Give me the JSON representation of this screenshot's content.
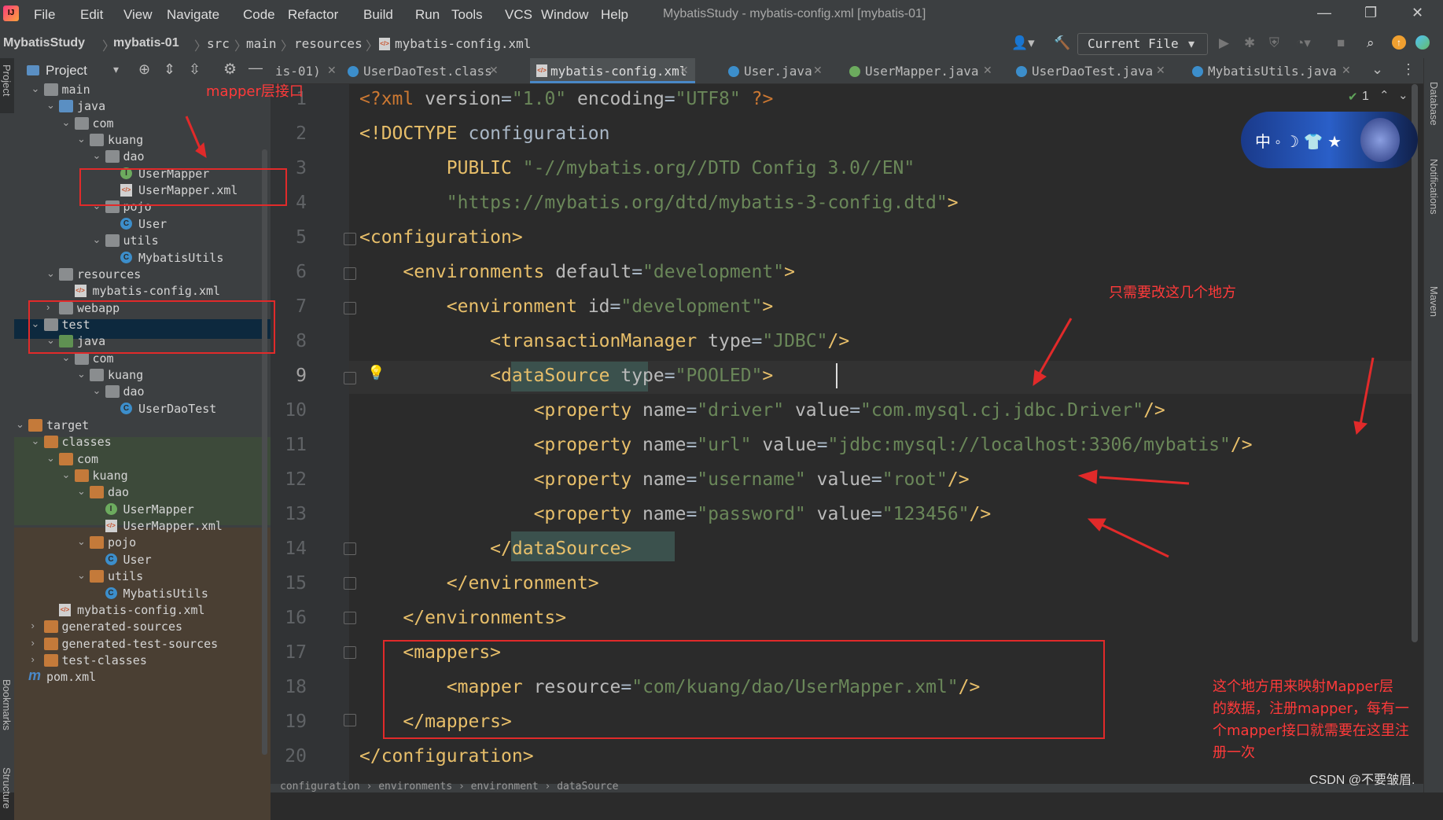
{
  "menubar": {
    "logo": "IJ",
    "items": [
      "File",
      "Edit",
      "View",
      "Navigate",
      "Code",
      "Refactor",
      "Build",
      "Run",
      "Tools",
      "VCS",
      "Window",
      "Help"
    ],
    "window_title": "MybatisStudy - mybatis-config.xml [mybatis-01]"
  },
  "navbar": {
    "breadcrumbs": [
      "MybatisStudy",
      "mybatis-01",
      "src",
      "main",
      "resources",
      "mybatis-config.xml"
    ],
    "run_config": "Current File"
  },
  "project_panel": {
    "title": "Project",
    "tree": [
      {
        "label": "main",
        "type": "folder"
      },
      {
        "label": "java",
        "type": "folder-blue"
      },
      {
        "label": "com",
        "type": "package"
      },
      {
        "label": "kuang",
        "type": "package"
      },
      {
        "label": "dao",
        "type": "package"
      },
      {
        "label": "UserMapper",
        "type": "interface"
      },
      {
        "label": "UserMapper.xml",
        "type": "xml"
      },
      {
        "label": "pojo",
        "type": "package"
      },
      {
        "label": "User",
        "type": "class"
      },
      {
        "label": "utils",
        "type": "package"
      },
      {
        "label": "MybatisUtils",
        "type": "class"
      },
      {
        "label": "resources",
        "type": "resources"
      },
      {
        "label": "mybatis-config.xml",
        "type": "xml"
      },
      {
        "label": "webapp",
        "type": "folder"
      },
      {
        "label": "test",
        "type": "folder"
      },
      {
        "label": "java",
        "type": "folder-green"
      },
      {
        "label": "com",
        "type": "package"
      },
      {
        "label": "kuang",
        "type": "package"
      },
      {
        "label": "dao",
        "type": "package"
      },
      {
        "label": "UserDaoTest",
        "type": "class"
      },
      {
        "label": "target",
        "type": "folder-orange"
      },
      {
        "label": "classes",
        "type": "folder-orange"
      },
      {
        "label": "com",
        "type": "folder-orange"
      },
      {
        "label": "kuang",
        "type": "folder-orange"
      },
      {
        "label": "dao",
        "type": "folder-orange"
      },
      {
        "label": "UserMapper",
        "type": "interface"
      },
      {
        "label": "UserMapper.xml",
        "type": "xml"
      },
      {
        "label": "pojo",
        "type": "folder-orange"
      },
      {
        "label": "User",
        "type": "class"
      },
      {
        "label": "utils",
        "type": "folder-orange"
      },
      {
        "label": "MybatisUtils",
        "type": "class"
      },
      {
        "label": "mybatis-config.xml",
        "type": "xml"
      },
      {
        "label": "generated-sources",
        "type": "folder-orange"
      },
      {
        "label": "generated-test-sources",
        "type": "folder-orange"
      },
      {
        "label": "test-classes",
        "type": "folder-orange"
      },
      {
        "label": "pom.xml",
        "type": "maven"
      }
    ]
  },
  "tabs": [
    {
      "label": "is-01)",
      "icon": "none"
    },
    {
      "label": "UserDaoTest.class",
      "icon": "class"
    },
    {
      "label": "mybatis-config.xml",
      "icon": "xml",
      "active": true
    },
    {
      "label": "User.java",
      "icon": "class"
    },
    {
      "label": "UserMapper.java",
      "icon": "interface"
    },
    {
      "label": "UserDaoTest.java",
      "icon": "class"
    },
    {
      "label": "MybatisUtils.java",
      "icon": "class"
    }
  ],
  "editor": {
    "inspection_count": "1",
    "line_numbers": [
      "1",
      "2",
      "3",
      "4",
      "5",
      "6",
      "7",
      "8",
      "9",
      "10",
      "11",
      "12",
      "13",
      "14",
      "15",
      "16",
      "17",
      "18",
      "19",
      "20"
    ]
  },
  "side_labels": {
    "left_top": "Project",
    "left_bottom1": "Bookmarks",
    "left_bottom2": "Structure",
    "right1": "Database",
    "right2": "Notifications",
    "right3": "Maven"
  },
  "widget": {
    "text": "中 ◦ ☽ 👕 ★"
  },
  "annotations": {
    "mapper_label": "mapper层接口",
    "change_label": "只需要改这几个地方",
    "mapper_note": [
      "这个地方用来映射Mapper层",
      "的数据，注册mapper，每有一",
      "个mapper接口就需要在这里注",
      "册一次"
    ]
  },
  "watermark": "CSDN @不要皱眉.",
  "status_breadcrumb": "configuration › environments › environment › dataSource"
}
